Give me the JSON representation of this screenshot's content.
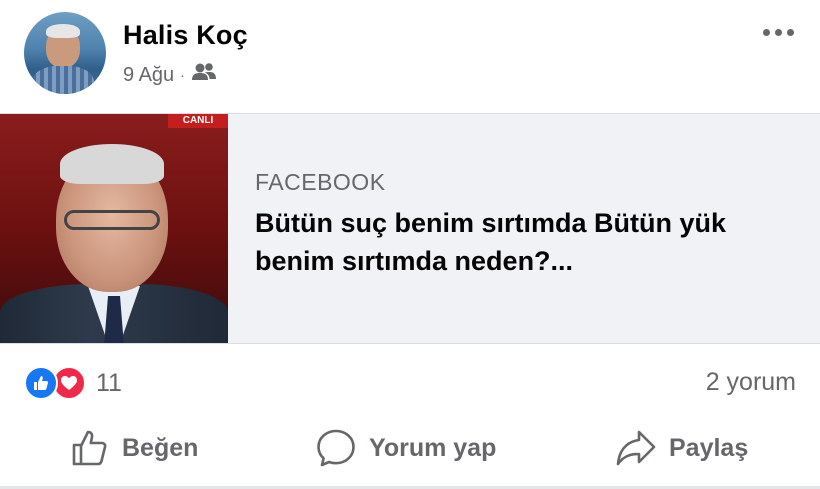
{
  "post": {
    "author": "Halis Koç",
    "date": "9 Ağu",
    "separator": "·",
    "privacy_icon": "friends-icon"
  },
  "link_card": {
    "thumbnail_banner": "CANLI",
    "source": "FACEBOOK",
    "title": "Bütün suç benim sırtımda Bütün yük benim sırtımda neden?..."
  },
  "stats": {
    "reaction_icons": [
      "like-reaction-icon",
      "love-reaction-icon"
    ],
    "reaction_count": "11",
    "comment_count": "2 yorum"
  },
  "actions": {
    "like": "Beğen",
    "comment": "Yorum yap",
    "share": "Paylaş"
  },
  "colors": {
    "like_blue": "#1877f2",
    "love_red": "#f02849",
    "secondary_text": "#65676b",
    "card_bg": "#f0f2f5"
  }
}
